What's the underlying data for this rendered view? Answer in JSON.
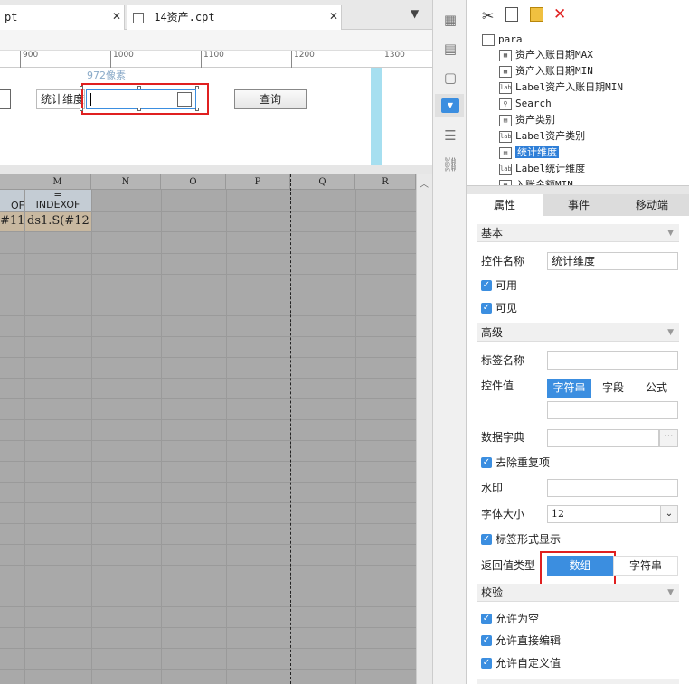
{
  "tabs": [
    {
      "label": "pt"
    },
    {
      "label": "14资产.cpt"
    }
  ],
  "ruler": {
    "marks": [
      "900",
      "1000",
      "1100",
      "1200",
      "1300"
    ]
  },
  "canvas": {
    "pixel_hint": "972像素",
    "stat_label": "统计维度",
    "query_button": "查询"
  },
  "grid": {
    "columns": [
      "M",
      "N",
      "O",
      "P",
      "Q",
      "R"
    ],
    "row1": {
      "left_frag": "OF",
      "m_frag": "=",
      "m_frag2": "INDEXOF"
    },
    "row2": {
      "left_frag": "#11",
      "m_text": "ds1.S(#12"
    }
  },
  "tree": {
    "root": "para",
    "items": [
      {
        "label": "资产入账日期MAX",
        "icon": "grid"
      },
      {
        "label": "资产入账日期MIN",
        "icon": "grid"
      },
      {
        "label": "Label资产入账日期MIN",
        "icon": "lab"
      },
      {
        "label": "Search",
        "icon": "search"
      },
      {
        "label": "资产类别",
        "icon": "grid"
      },
      {
        "label": "Label资产类别",
        "icon": "lab"
      },
      {
        "label": "统计维度",
        "icon": "grid",
        "selected": true
      },
      {
        "label": "Label统计维度",
        "icon": "lab"
      },
      {
        "label": "入账金额MIN",
        "icon": "grid"
      }
    ]
  },
  "prop_tabs": [
    "属性",
    "事件",
    "移动端"
  ],
  "sections": {
    "basic": "基本",
    "advanced": "高级",
    "validate": "校验"
  },
  "props": {
    "control_name_label": "控件名称",
    "control_name_value": "统计维度",
    "enabled_label": "可用",
    "visible_label": "可见",
    "tag_name_label": "标签名称",
    "tag_name_value": "",
    "control_value_label": "控件值",
    "value_modes": [
      "字符串",
      "字段",
      "公式"
    ],
    "control_value_value": "",
    "dict_label": "数据字典",
    "dict_btn": "···",
    "dedupe_label": "去除重复项",
    "watermark_label": "水印",
    "font_size_label": "字体大小",
    "font_size_value": "12",
    "tag_display_label": "标签形式显示",
    "return_type_label": "返回值类型",
    "return_types": [
      "数组",
      "字符串"
    ],
    "allow_empty": "允许为空",
    "allow_edit": "允许直接编辑",
    "allow_custom": "允许自定义值"
  },
  "colors": {
    "accent": "#3b8ee0",
    "highlight_red": "#e02020",
    "selected_tree": "#2f7fd8"
  }
}
